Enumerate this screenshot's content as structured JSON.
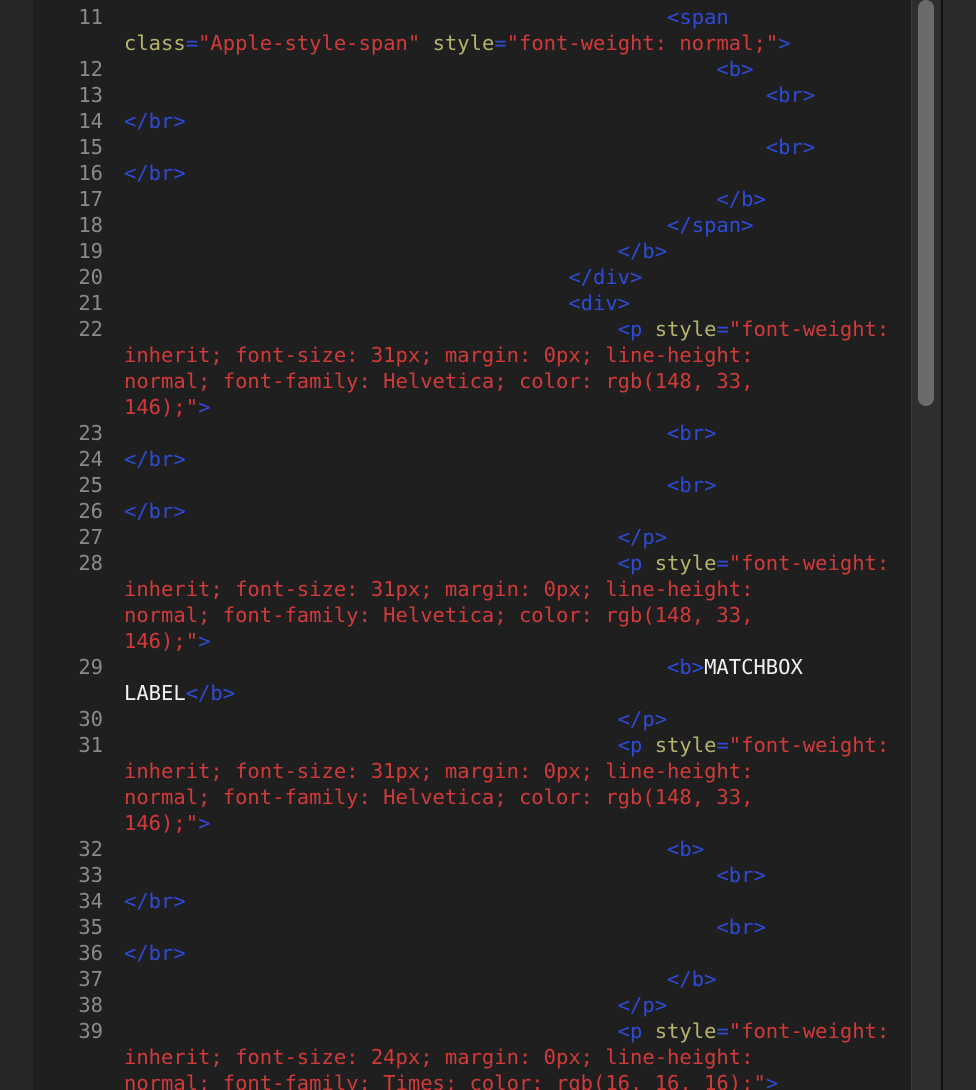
{
  "editor": {
    "rows": [
      {
        "n": "11",
        "segs": [
          {
            "c": "tag",
            "t": "                                            <span"
          }
        ]
      },
      {
        "n": "",
        "segs": [
          {
            "c": "attr",
            "t": "class"
          },
          {
            "c": "tag",
            "t": "="
          },
          {
            "c": "val",
            "t": "\"Apple-style-span\""
          },
          {
            "c": "attr",
            "t": " style"
          },
          {
            "c": "tag",
            "t": "="
          },
          {
            "c": "val",
            "t": "\"font-weight: normal;\""
          },
          {
            "c": "tag",
            "t": ">"
          }
        ]
      },
      {
        "n": "12",
        "segs": [
          {
            "c": "tag",
            "t": "                                                <b>"
          }
        ]
      },
      {
        "n": "13",
        "segs": [
          {
            "c": "tag",
            "t": "                                                    <br>"
          }
        ]
      },
      {
        "n": "14",
        "segs": [
          {
            "c": "tag",
            "t": "</br>"
          }
        ]
      },
      {
        "n": "15",
        "segs": [
          {
            "c": "tag",
            "t": "                                                    <br>"
          }
        ]
      },
      {
        "n": "16",
        "segs": [
          {
            "c": "tag",
            "t": "</br>"
          }
        ]
      },
      {
        "n": "17",
        "segs": [
          {
            "c": "tag",
            "t": "                                                </b>"
          }
        ]
      },
      {
        "n": "18",
        "segs": [
          {
            "c": "tag",
            "t": "                                            </span>"
          }
        ]
      },
      {
        "n": "19",
        "segs": [
          {
            "c": "tag",
            "t": "                                        </b>"
          }
        ]
      },
      {
        "n": "20",
        "segs": [
          {
            "c": "tag",
            "t": "                                    </div>"
          }
        ]
      },
      {
        "n": "21",
        "segs": [
          {
            "c": "tag",
            "t": "                                    <div>"
          }
        ]
      },
      {
        "n": "22",
        "segs": [
          {
            "c": "tag",
            "t": "                                        <p"
          },
          {
            "c": "attr",
            "t": " style"
          },
          {
            "c": "tag",
            "t": "="
          },
          {
            "c": "val",
            "t": "\"font-weight:"
          }
        ]
      },
      {
        "n": "",
        "segs": [
          {
            "c": "val",
            "t": "inherit; font-size: 31px; margin: 0px; line-height:"
          }
        ]
      },
      {
        "n": "",
        "segs": [
          {
            "c": "val",
            "t": "normal; font-family: Helvetica; color: rgb(148, 33,"
          }
        ]
      },
      {
        "n": "",
        "segs": [
          {
            "c": "val",
            "t": "146);\""
          },
          {
            "c": "tag",
            "t": ">"
          }
        ]
      },
      {
        "n": "23",
        "segs": [
          {
            "c": "tag",
            "t": "                                            <br>"
          }
        ]
      },
      {
        "n": "24",
        "segs": [
          {
            "c": "tag",
            "t": "</br>"
          }
        ]
      },
      {
        "n": "25",
        "segs": [
          {
            "c": "tag",
            "t": "                                            <br>"
          }
        ]
      },
      {
        "n": "26",
        "segs": [
          {
            "c": "tag",
            "t": "</br>"
          }
        ]
      },
      {
        "n": "27",
        "segs": [
          {
            "c": "tag",
            "t": "                                        </p>"
          }
        ]
      },
      {
        "n": "28",
        "segs": [
          {
            "c": "tag",
            "t": "                                        <p"
          },
          {
            "c": "attr",
            "t": " style"
          },
          {
            "c": "tag",
            "t": "="
          },
          {
            "c": "val",
            "t": "\"font-weight:"
          }
        ]
      },
      {
        "n": "",
        "segs": [
          {
            "c": "val",
            "t": "inherit; font-size: 31px; margin: 0px; line-height:"
          }
        ]
      },
      {
        "n": "",
        "segs": [
          {
            "c": "val",
            "t": "normal; font-family: Helvetica; color: rgb(148, 33,"
          }
        ]
      },
      {
        "n": "",
        "segs": [
          {
            "c": "val",
            "t": "146);\""
          },
          {
            "c": "tag",
            "t": ">"
          }
        ]
      },
      {
        "n": "29",
        "segs": [
          {
            "c": "tag",
            "t": "                                            <b>"
          },
          {
            "c": "plain",
            "t": "MATCHBOX"
          }
        ]
      },
      {
        "n": "",
        "segs": [
          {
            "c": "plain",
            "t": "LABEL"
          },
          {
            "c": "tag",
            "t": "</b>"
          }
        ]
      },
      {
        "n": "30",
        "segs": [
          {
            "c": "tag",
            "t": "                                        </p>"
          }
        ]
      },
      {
        "n": "31",
        "segs": [
          {
            "c": "tag",
            "t": "                                        <p"
          },
          {
            "c": "attr",
            "t": " style"
          },
          {
            "c": "tag",
            "t": "="
          },
          {
            "c": "val",
            "t": "\"font-weight:"
          }
        ]
      },
      {
        "n": "",
        "segs": [
          {
            "c": "val",
            "t": "inherit; font-size: 31px; margin: 0px; line-height:"
          }
        ]
      },
      {
        "n": "",
        "segs": [
          {
            "c": "val",
            "t": "normal; font-family: Helvetica; color: rgb(148, 33,"
          }
        ]
      },
      {
        "n": "",
        "segs": [
          {
            "c": "val",
            "t": "146);\""
          },
          {
            "c": "tag",
            "t": ">"
          }
        ]
      },
      {
        "n": "32",
        "segs": [
          {
            "c": "tag",
            "t": "                                            <b>"
          }
        ]
      },
      {
        "n": "33",
        "segs": [
          {
            "c": "tag",
            "t": "                                                <br>"
          }
        ]
      },
      {
        "n": "34",
        "segs": [
          {
            "c": "tag",
            "t": "</br>"
          }
        ]
      },
      {
        "n": "35",
        "segs": [
          {
            "c": "tag",
            "t": "                                                <br>"
          }
        ]
      },
      {
        "n": "36",
        "segs": [
          {
            "c": "tag",
            "t": "</br>"
          }
        ]
      },
      {
        "n": "37",
        "segs": [
          {
            "c": "tag",
            "t": "                                            </b>"
          }
        ]
      },
      {
        "n": "38",
        "segs": [
          {
            "c": "tag",
            "t": "                                        </p>"
          }
        ]
      },
      {
        "n": "39",
        "segs": [
          {
            "c": "tag",
            "t": "                                        <p"
          },
          {
            "c": "attr",
            "t": " style"
          },
          {
            "c": "tag",
            "t": "="
          },
          {
            "c": "val",
            "t": "\"font-weight:"
          }
        ]
      },
      {
        "n": "",
        "segs": [
          {
            "c": "val",
            "t": "inherit; font-size: 24px; margin: 0px; line-height:"
          }
        ]
      },
      {
        "n": "",
        "segs": [
          {
            "c": "val",
            "t": "normal; font-family: Times; color: rgb(16, 16, 16);\""
          },
          {
            "c": "tag",
            "t": ">"
          }
        ]
      }
    ]
  }
}
